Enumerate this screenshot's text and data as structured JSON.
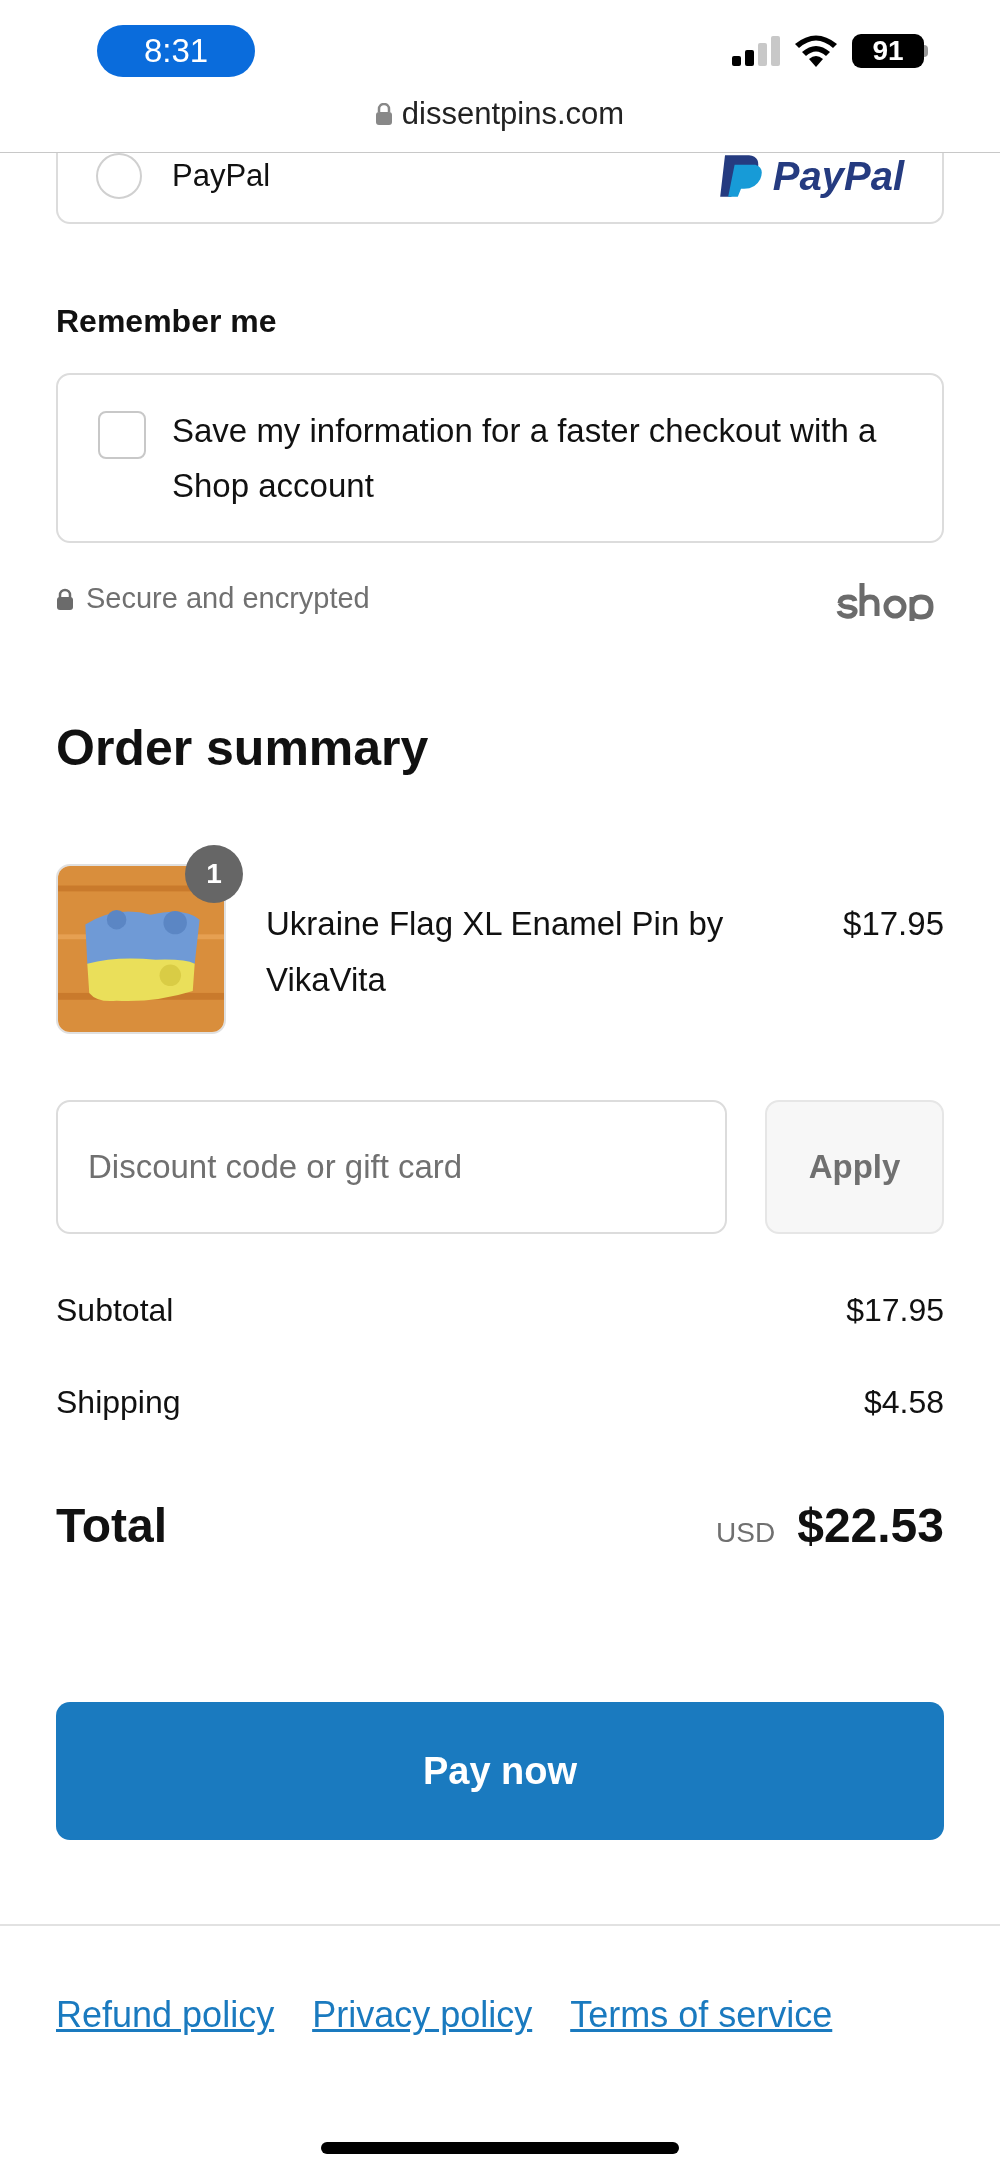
{
  "status_bar": {
    "time": "8:31",
    "battery": "91"
  },
  "address_bar": {
    "url": "dissentpins.com"
  },
  "payment_option": {
    "label": "PayPal",
    "logo_text": "PayPal",
    "selected": false
  },
  "remember_me": {
    "title": "Remember me",
    "checkbox": {
      "label": "Save my information for a faster checkout with a Shop account",
      "checked": false
    },
    "secure_note": "Secure and encrypted"
  },
  "order_summary": {
    "title": "Order summary",
    "items": [
      {
        "name": "Ukraine Flag XL Enamel Pin by VikaVita",
        "quantity": "1",
        "price": "$17.95"
      }
    ],
    "discount": {
      "placeholder": "Discount code or gift card",
      "button": "Apply"
    },
    "lines": [
      {
        "label": "Subtotal",
        "value": "$17.95"
      },
      {
        "label": "Shipping",
        "value": "$4.58"
      }
    ],
    "total": {
      "label": "Total",
      "currency": "USD",
      "value": "$22.53"
    }
  },
  "pay_button": "Pay now",
  "footer_links": [
    "Refund policy",
    "Privacy policy",
    "Terms of service"
  ]
}
